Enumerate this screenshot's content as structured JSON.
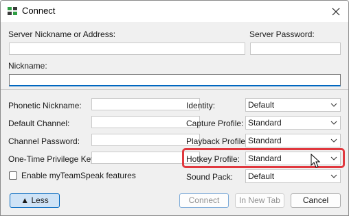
{
  "window": {
    "title": "Connect"
  },
  "labels": {
    "server": "Server Nickname or Address:",
    "server_password": "Server Password:",
    "nickname": "Nickname:",
    "phonetic": "Phonetic Nickname:",
    "default_channel": "Default Channel:",
    "channel_password": "Channel Password:",
    "privilege_key": "One-Time Privilege Key:",
    "identity": "Identity:",
    "capture": "Capture Profile:",
    "playback": "Playback Profile:",
    "hotkey": "Hotkey Profile:",
    "sound_pack": "Sound Pack:"
  },
  "inputs": {
    "server": "",
    "server_password": "",
    "nickname": "",
    "phonetic": "",
    "default_channel": "",
    "channel_password": "",
    "privilege_key": ""
  },
  "selects": {
    "identity": "Default",
    "capture": "Standard",
    "playback": "Standard",
    "hotkey": "Standard",
    "sound_pack": "Default"
  },
  "checkbox": {
    "label": "Enable myTeamSpeak features",
    "checked": false
  },
  "buttons": {
    "less": "Less",
    "less_icon": "▲",
    "connect": "Connect",
    "new_tab": "In New Tab",
    "cancel": "Cancel"
  },
  "colors": {
    "highlight": "#e0383e",
    "accent": "#0067c0"
  }
}
